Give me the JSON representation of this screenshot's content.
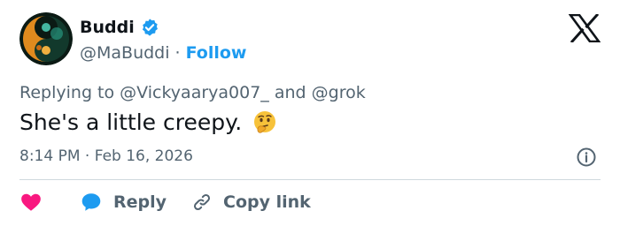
{
  "header": {
    "display_name": "Buddi",
    "handle": "@MaBuddi",
    "separator": "·",
    "follow_label": "Follow"
  },
  "tweet": {
    "replying_prefix": "Replying to",
    "replying_to_1": "@Vickyaarya007_",
    "replying_and": "and",
    "replying_to_2": "@grok",
    "text": "She's a little creepy.",
    "emoji": "thinking-face",
    "time": "8:14 PM",
    "date": "Feb 16, 2026",
    "timestamp_separator": "·"
  },
  "actions": {
    "reply_label": "Reply",
    "copy_label": "Copy link"
  },
  "icons": {
    "verified": "verified-badge-icon",
    "logo": "x-logo-icon",
    "info": "info-icon",
    "like": "heart-icon",
    "reply": "speech-bubble-icon",
    "copy": "link-icon"
  },
  "colors": {
    "accent": "#1d9bf0",
    "text_primary": "#0f1419",
    "text_secondary": "#536471",
    "like": "#f91880",
    "divider": "#cfd9de"
  }
}
